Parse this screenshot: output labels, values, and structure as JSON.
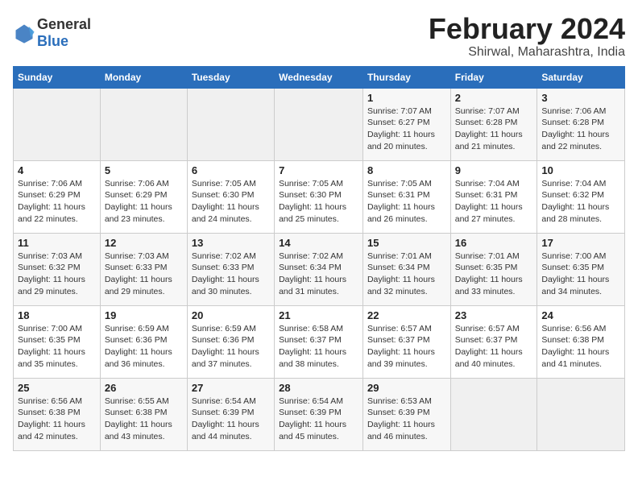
{
  "header": {
    "logo_general": "General",
    "logo_blue": "Blue",
    "month_year": "February 2024",
    "location": "Shirwal, Maharashtra, India"
  },
  "days_of_week": [
    "Sunday",
    "Monday",
    "Tuesday",
    "Wednesday",
    "Thursday",
    "Friday",
    "Saturday"
  ],
  "weeks": [
    [
      {
        "day": "",
        "empty": true
      },
      {
        "day": "",
        "empty": true
      },
      {
        "day": "",
        "empty": true
      },
      {
        "day": "",
        "empty": true
      },
      {
        "day": "1",
        "sunrise": "7:07 AM",
        "sunset": "6:27 PM",
        "daylight": "11 hours and 20 minutes."
      },
      {
        "day": "2",
        "sunrise": "7:07 AM",
        "sunset": "6:28 PM",
        "daylight": "11 hours and 21 minutes."
      },
      {
        "day": "3",
        "sunrise": "7:06 AM",
        "sunset": "6:28 PM",
        "daylight": "11 hours and 22 minutes."
      }
    ],
    [
      {
        "day": "4",
        "sunrise": "7:06 AM",
        "sunset": "6:29 PM",
        "daylight": "11 hours and 22 minutes."
      },
      {
        "day": "5",
        "sunrise": "7:06 AM",
        "sunset": "6:29 PM",
        "daylight": "11 hours and 23 minutes."
      },
      {
        "day": "6",
        "sunrise": "7:05 AM",
        "sunset": "6:30 PM",
        "daylight": "11 hours and 24 minutes."
      },
      {
        "day": "7",
        "sunrise": "7:05 AM",
        "sunset": "6:30 PM",
        "daylight": "11 hours and 25 minutes."
      },
      {
        "day": "8",
        "sunrise": "7:05 AM",
        "sunset": "6:31 PM",
        "daylight": "11 hours and 26 minutes."
      },
      {
        "day": "9",
        "sunrise": "7:04 AM",
        "sunset": "6:31 PM",
        "daylight": "11 hours and 27 minutes."
      },
      {
        "day": "10",
        "sunrise": "7:04 AM",
        "sunset": "6:32 PM",
        "daylight": "11 hours and 28 minutes."
      }
    ],
    [
      {
        "day": "11",
        "sunrise": "7:03 AM",
        "sunset": "6:32 PM",
        "daylight": "11 hours and 29 minutes."
      },
      {
        "day": "12",
        "sunrise": "7:03 AM",
        "sunset": "6:33 PM",
        "daylight": "11 hours and 29 minutes."
      },
      {
        "day": "13",
        "sunrise": "7:02 AM",
        "sunset": "6:33 PM",
        "daylight": "11 hours and 30 minutes."
      },
      {
        "day": "14",
        "sunrise": "7:02 AM",
        "sunset": "6:34 PM",
        "daylight": "11 hours and 31 minutes."
      },
      {
        "day": "15",
        "sunrise": "7:01 AM",
        "sunset": "6:34 PM",
        "daylight": "11 hours and 32 minutes."
      },
      {
        "day": "16",
        "sunrise": "7:01 AM",
        "sunset": "6:35 PM",
        "daylight": "11 hours and 33 minutes."
      },
      {
        "day": "17",
        "sunrise": "7:00 AM",
        "sunset": "6:35 PM",
        "daylight": "11 hours and 34 minutes."
      }
    ],
    [
      {
        "day": "18",
        "sunrise": "7:00 AM",
        "sunset": "6:35 PM",
        "daylight": "11 hours and 35 minutes."
      },
      {
        "day": "19",
        "sunrise": "6:59 AM",
        "sunset": "6:36 PM",
        "daylight": "11 hours and 36 minutes."
      },
      {
        "day": "20",
        "sunrise": "6:59 AM",
        "sunset": "6:36 PM",
        "daylight": "11 hours and 37 minutes."
      },
      {
        "day": "21",
        "sunrise": "6:58 AM",
        "sunset": "6:37 PM",
        "daylight": "11 hours and 38 minutes."
      },
      {
        "day": "22",
        "sunrise": "6:57 AM",
        "sunset": "6:37 PM",
        "daylight": "11 hours and 39 minutes."
      },
      {
        "day": "23",
        "sunrise": "6:57 AM",
        "sunset": "6:37 PM",
        "daylight": "11 hours and 40 minutes."
      },
      {
        "day": "24",
        "sunrise": "6:56 AM",
        "sunset": "6:38 PM",
        "daylight": "11 hours and 41 minutes."
      }
    ],
    [
      {
        "day": "25",
        "sunrise": "6:56 AM",
        "sunset": "6:38 PM",
        "daylight": "11 hours and 42 minutes."
      },
      {
        "day": "26",
        "sunrise": "6:55 AM",
        "sunset": "6:38 PM",
        "daylight": "11 hours and 43 minutes."
      },
      {
        "day": "27",
        "sunrise": "6:54 AM",
        "sunset": "6:39 PM",
        "daylight": "11 hours and 44 minutes."
      },
      {
        "day": "28",
        "sunrise": "6:54 AM",
        "sunset": "6:39 PM",
        "daylight": "11 hours and 45 minutes."
      },
      {
        "day": "29",
        "sunrise": "6:53 AM",
        "sunset": "6:39 PM",
        "daylight": "11 hours and 46 minutes."
      },
      {
        "day": "",
        "empty": true
      },
      {
        "day": "",
        "empty": true
      }
    ]
  ]
}
